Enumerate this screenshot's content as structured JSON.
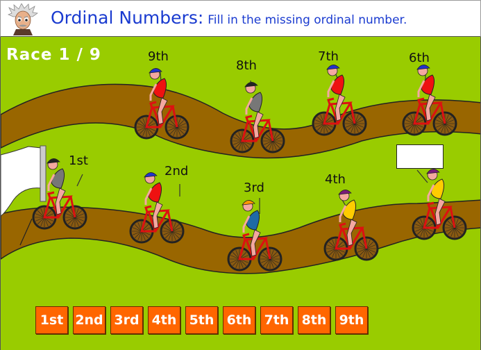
{
  "header": {
    "mascot_icon": "einstein-cartoon-icon",
    "title": "Ordinal Numbers:",
    "subtitle": "Fill in the missing ordinal number."
  },
  "race": {
    "label": "Race 1 / 9",
    "current": 1,
    "total": 9
  },
  "riders": [
    {
      "place": "9th",
      "shirt": "#ee1111",
      "helmet": "#2233cc",
      "row": "top"
    },
    {
      "place": "8th",
      "shirt": "#777777",
      "helmet": "#222222",
      "row": "top"
    },
    {
      "place": "7th",
      "shirt": "#ee1111",
      "helmet": "#2233cc",
      "row": "top"
    },
    {
      "place": "6th",
      "shirt": "#ee1111",
      "helmet": "#2233cc",
      "row": "top"
    },
    {
      "place": "1st",
      "shirt": "#777777",
      "helmet": "#222222",
      "row": "bottom"
    },
    {
      "place": "2nd",
      "shirt": "#ee1111",
      "helmet": "#2233cc",
      "row": "bottom"
    },
    {
      "place": "3rd",
      "shirt": "#1f6aa5",
      "helmet": "#ff9900",
      "row": "bottom"
    },
    {
      "place": "4th",
      "shirt": "#ffcc00",
      "helmet": "#7a1a7a",
      "row": "bottom"
    },
    {
      "place": "",
      "shirt": "#ffcc00",
      "helmet": "#7a1a7a",
      "row": "bottom",
      "missing": true
    }
  ],
  "answer_options": [
    "1st",
    "2nd",
    "3rd",
    "4th",
    "5th",
    "6th",
    "7th",
    "8th",
    "9th"
  ],
  "colors": {
    "grass": "#99cc00",
    "track": "#996600",
    "button": "#ff6600",
    "title": "#1a3bd0"
  }
}
